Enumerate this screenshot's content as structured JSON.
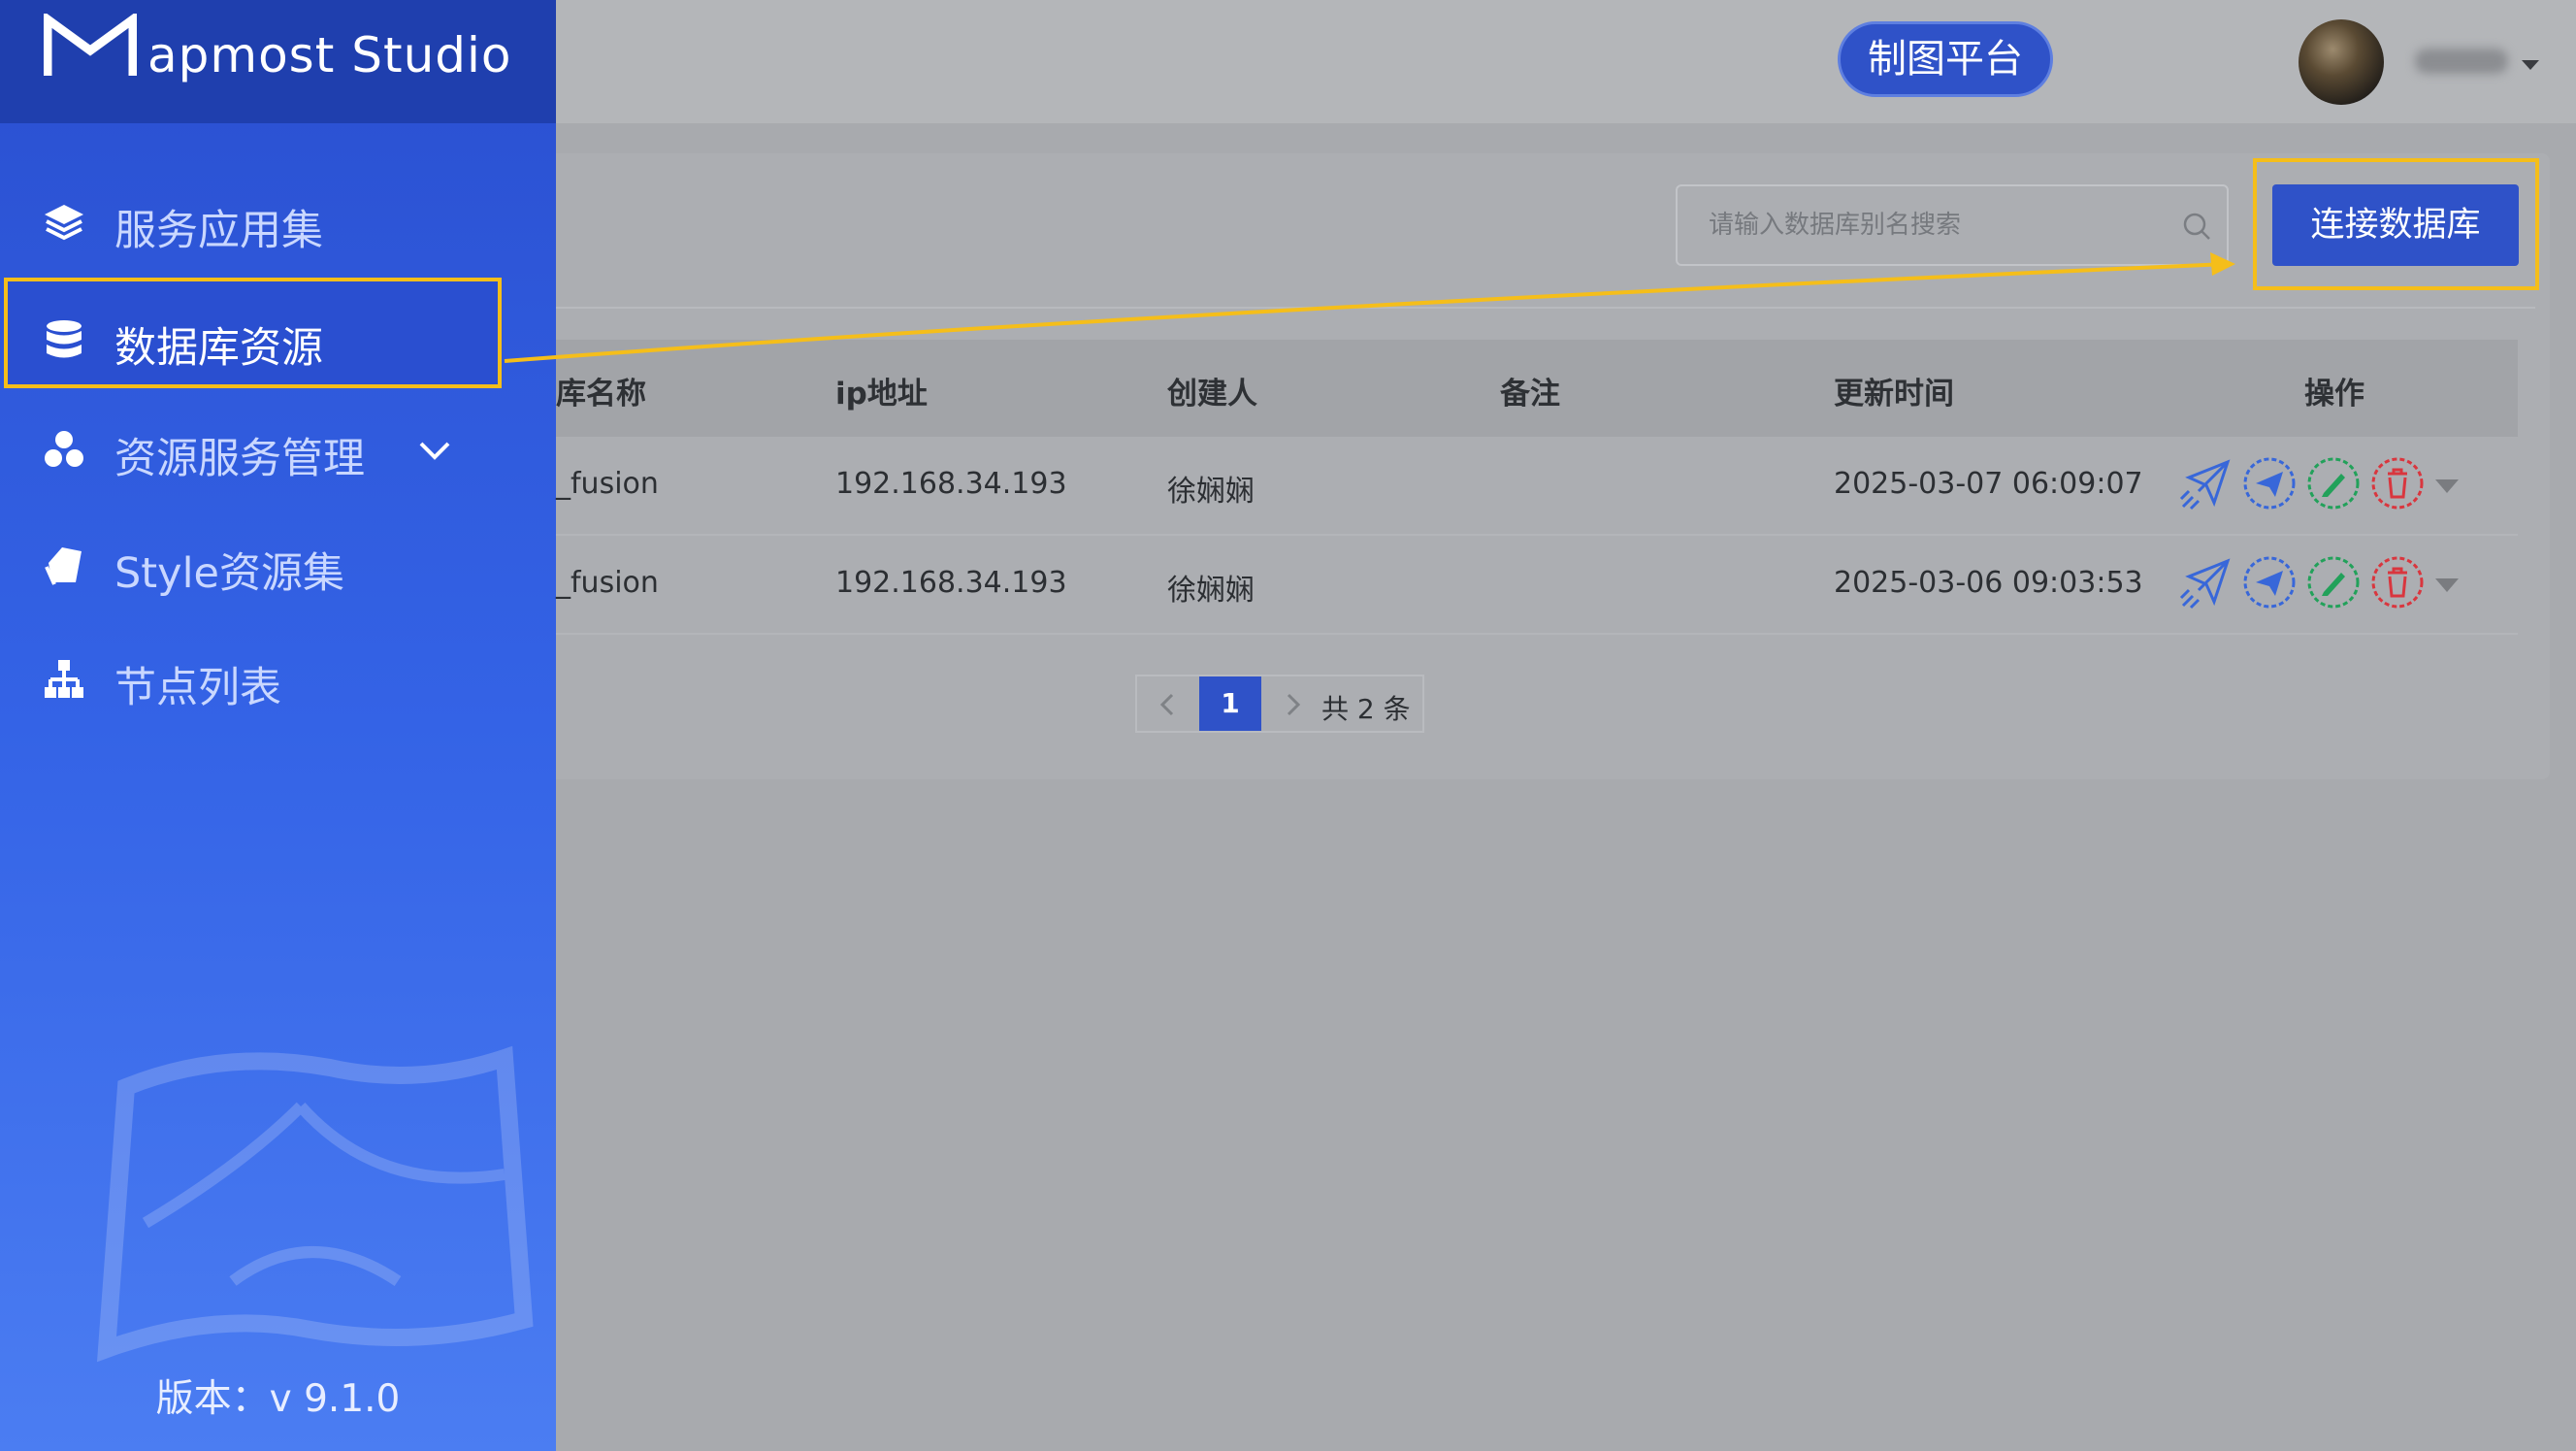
{
  "app": {
    "logo_text": "apmost Studio",
    "version": "版本：v 9.1.0"
  },
  "sidebar": {
    "items": [
      {
        "label": "服务应用集",
        "icon": "layers-icon"
      },
      {
        "label": "数据库资源",
        "icon": "database-icon",
        "active": true
      },
      {
        "label": "资源服务管理",
        "icon": "cubes-icon",
        "expandable": true
      },
      {
        "label": "Style资源集",
        "icon": "tag-icon"
      },
      {
        "label": "节点列表",
        "icon": "node-tree-icon"
      }
    ]
  },
  "header": {
    "platform_button": "制图平台"
  },
  "toolbar": {
    "search_placeholder": "请输入数据库别名搜索",
    "connect_button": "连接数据库"
  },
  "table": {
    "columns": [
      "库名称",
      "ip地址",
      "创建人",
      "备注",
      "更新时间",
      "操作"
    ],
    "rows": [
      {
        "name": "_fusion",
        "ip": "192.168.34.193",
        "creator": "徐娴娴",
        "remark": "",
        "updated": "2025-03-07 06:09:07"
      },
      {
        "name": "_fusion",
        "ip": "192.168.34.193",
        "creator": "徐娴娴",
        "remark": "",
        "updated": "2025-03-06 09:03:53"
      }
    ]
  },
  "pagination": {
    "current": "1",
    "total_text": "共 2 条"
  },
  "colors": {
    "primary": "#2f52c8",
    "highlight": "#f5be1a",
    "sidebar": "#2a4fd0"
  }
}
